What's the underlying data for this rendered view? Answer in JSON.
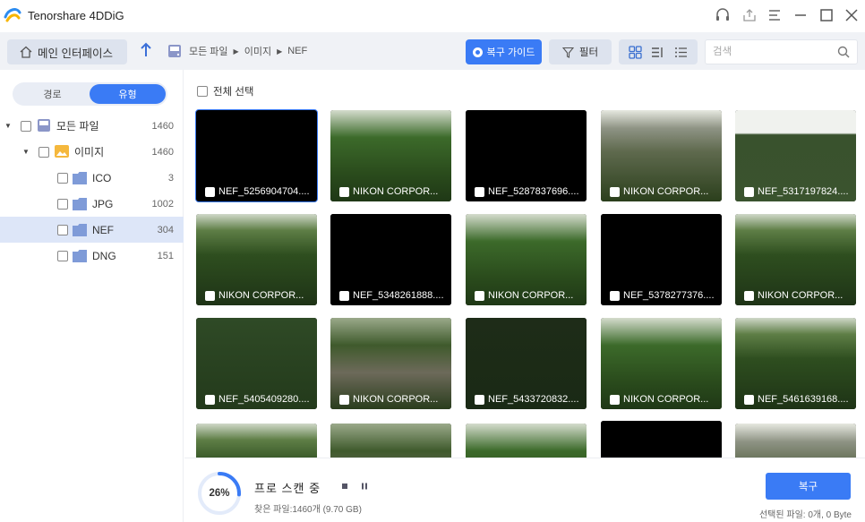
{
  "app": {
    "title": "Tenorshare 4DDiG"
  },
  "toolbar": {
    "home_label": "메인 인터페이스",
    "breadcrumb": [
      "모든 파일",
      "이미지",
      "NEF"
    ],
    "guide_label": "복구 가이드",
    "filter_label": "필터",
    "search_placeholder": "검색"
  },
  "sidebar": {
    "tabs": [
      "경로",
      "유형"
    ],
    "tree": [
      {
        "label": "모든 파일",
        "count": "1460"
      },
      {
        "label": "이미지",
        "count": "1460"
      },
      {
        "label": "ICO",
        "count": "3"
      },
      {
        "label": "JPG",
        "count": "1002"
      },
      {
        "label": "NEF",
        "count": "304"
      },
      {
        "label": "DNG",
        "count": "151"
      }
    ]
  },
  "main": {
    "select_all_label": "전체 선택",
    "thumbnails": [
      {
        "name": "NEF_5256904704...."
      },
      {
        "name": "NIKON CORPOR..."
      },
      {
        "name": "NEF_5287837696...."
      },
      {
        "name": "NIKON CORPOR..."
      },
      {
        "name": "NEF_5317197824...."
      },
      {
        "name": "NIKON CORPOR..."
      },
      {
        "name": "NEF_5348261888...."
      },
      {
        "name": "NIKON CORPOR..."
      },
      {
        "name": "NEF_5378277376...."
      },
      {
        "name": "NIKON CORPOR..."
      },
      {
        "name": "NEF_5405409280...."
      },
      {
        "name": "NIKON CORPOR..."
      },
      {
        "name": "NEF_5433720832...."
      },
      {
        "name": "NIKON CORPOR..."
      },
      {
        "name": "NEF_5461639168...."
      }
    ]
  },
  "bottom": {
    "progress_percent": 26,
    "progress_label": "26%",
    "scan_title": "프로 스캔 중",
    "found_text": "찾은 파일:1460개 (9.70 GB)",
    "recover_label": "복구",
    "selected_text": "선택된 파일: 0개, 0 Byte"
  },
  "colors": {
    "accent": "#3a7bf5",
    "sidebar_selected": "#dde6f8",
    "toolbar_bg": "#f0f2f6"
  }
}
